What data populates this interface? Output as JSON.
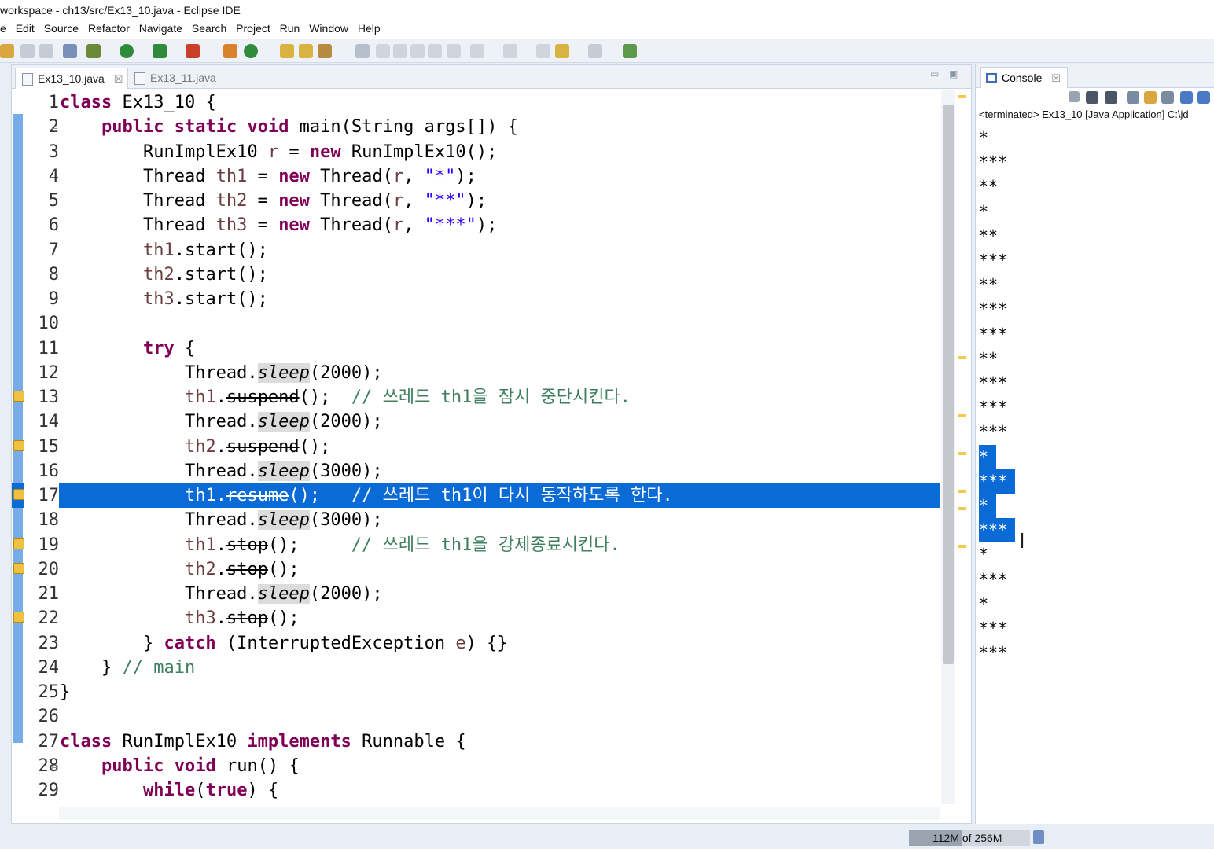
{
  "window": {
    "title": "workspace - ch13/src/Ex13_10.java - Eclipse IDE"
  },
  "menu": [
    "e",
    "Edit",
    "Source",
    "Refactor",
    "Navigate",
    "Search",
    "Project",
    "Run",
    "Window",
    "Help"
  ],
  "tabs": [
    {
      "label": "Ex13_10.java",
      "active": true
    },
    {
      "label": "Ex13_11.java",
      "active": false
    }
  ],
  "editor": {
    "lines": [
      {
        "n": "1",
        "text": "class Ex13_10 {"
      },
      {
        "n": "2",
        "text": "    public static void main(String args[]) {"
      },
      {
        "n": "3",
        "text": "        RunImplEx10 r = new RunImplEx10();"
      },
      {
        "n": "4",
        "text": "        Thread th1 = new Thread(r, \"*\");"
      },
      {
        "n": "5",
        "text": "        Thread th2 = new Thread(r, \"**\");"
      },
      {
        "n": "6",
        "text": "        Thread th3 = new Thread(r, \"***\");"
      },
      {
        "n": "7",
        "text": "        th1.start();"
      },
      {
        "n": "8",
        "text": "        th2.start();"
      },
      {
        "n": "9",
        "text": "        th3.start();"
      },
      {
        "n": "10",
        "text": ""
      },
      {
        "n": "11",
        "text": "        try {"
      },
      {
        "n": "12",
        "text": "            Thread.sleep(2000);"
      },
      {
        "n": "13",
        "text": "            th1.suspend();  // 쓰레드 th1을 잠시 중단시킨다."
      },
      {
        "n": "14",
        "text": "            Thread.sleep(2000);"
      },
      {
        "n": "15",
        "text": "            th2.suspend();"
      },
      {
        "n": "16",
        "text": "            Thread.sleep(3000);"
      },
      {
        "n": "17",
        "text": "            th1.resume();   // 쓰레드 th1이 다시 동작하도록 한다."
      },
      {
        "n": "18",
        "text": "            Thread.sleep(3000);"
      },
      {
        "n": "19",
        "text": "            th1.stop();     // 쓰레드 th1을 강제종료시킨다."
      },
      {
        "n": "20",
        "text": "            th2.stop();"
      },
      {
        "n": "21",
        "text": "            Thread.sleep(2000);"
      },
      {
        "n": "22",
        "text": "            th3.stop();"
      },
      {
        "n": "23",
        "text": "        } catch (InterruptedException e) {}"
      },
      {
        "n": "24",
        "text": "    } // main"
      },
      {
        "n": "25",
        "text": "}"
      },
      {
        "n": "26",
        "text": ""
      },
      {
        "n": "27",
        "text": "class RunImplEx10 implements Runnable {"
      },
      {
        "n": "28",
        "text": "    public void run() {"
      },
      {
        "n": "29",
        "text": "        while(true) {"
      }
    ],
    "highlighted_line": 17
  },
  "console": {
    "tab_label": "Console",
    "status": "<terminated> Ex13_10 [Java Application] C:\\jd",
    "output": [
      "*",
      "***",
      "**",
      "*",
      "**",
      "***",
      "**",
      "***",
      "***",
      "**",
      "***",
      "***",
      "***",
      "*",
      "***",
      "*",
      "***",
      "*",
      "***",
      "*",
      "***",
      "***"
    ],
    "selected_range": [
      13,
      16
    ]
  },
  "status": {
    "heap": "112M of 256M",
    "heap_used_fraction": 0.4375
  }
}
